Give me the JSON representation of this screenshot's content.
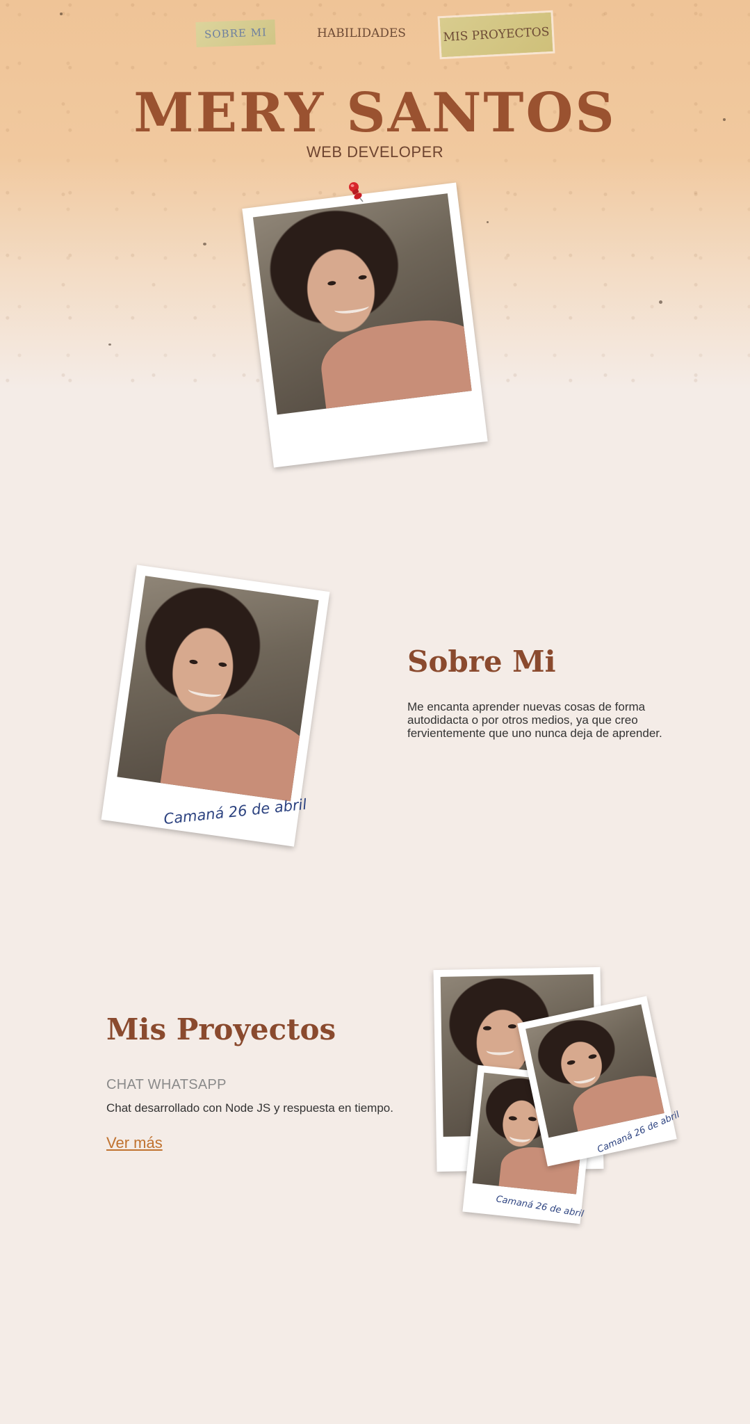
{
  "nav": {
    "items": [
      {
        "label": "SOBRE MI"
      },
      {
        "label": "HABILIDADES"
      },
      {
        "label": "MIS PROYECTOS"
      }
    ]
  },
  "hero": {
    "name": "MERY SANTOS",
    "role": "WEB DEVELOPER",
    "photo_icon": "pushpin-icon"
  },
  "about": {
    "title": "Sobre Mi",
    "text": "Me encanta aprender nuevas cosas de forma autodidacta o por otros medios, ya que creo fervientemente que uno nunca deja de aprender.",
    "photo_caption": "Camaná 26 de abril"
  },
  "projects": {
    "title": "Mis Proyectos",
    "project_name": "CHAT WHATSAPP",
    "project_desc": "Chat desarrollado con Node JS y respuesta en tiempo.",
    "more_label": "Ver más",
    "photo_captions": [
      "Camaná 26 de abril",
      "Camaná 26 de abril"
    ]
  },
  "colors": {
    "accent": "#9a5230",
    "link": "#c0722f",
    "caption": "#2d4380",
    "background": "#f4ece7"
  }
}
